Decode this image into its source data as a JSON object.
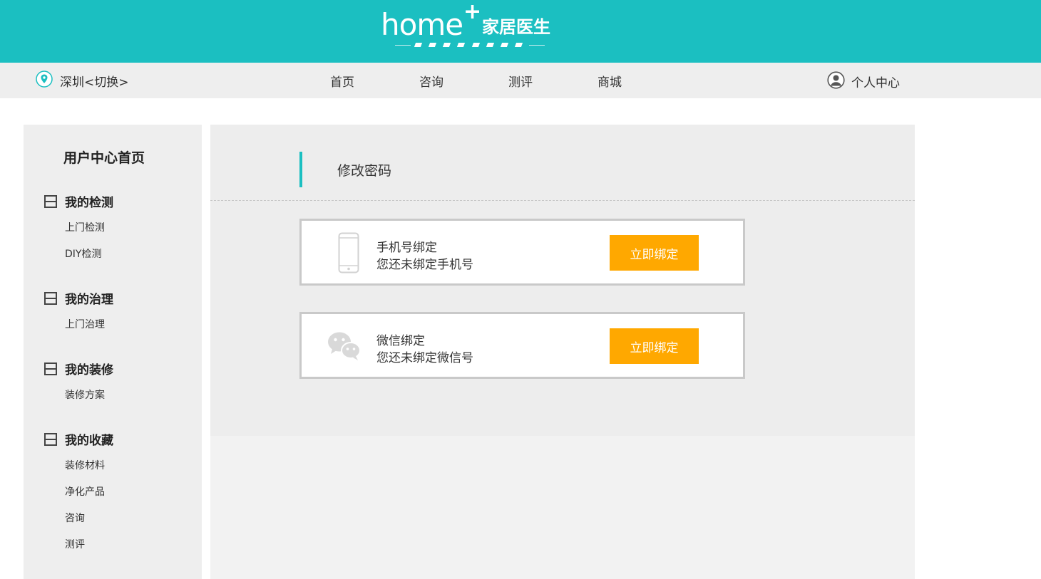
{
  "brand": {
    "logo_home": "home",
    "logo_plus": "+",
    "logo_cn": "家居医生",
    "color_primary": "#1bbfc1",
    "color_accent": "#ffa800"
  },
  "navbar": {
    "city_icon": "location-pin-icon",
    "city_label": "深圳<切换>",
    "items": [
      {
        "label": "首页"
      },
      {
        "label": "咨询"
      },
      {
        "label": "测评"
      },
      {
        "label": "商城"
      }
    ],
    "user_icon": "user-avatar-icon",
    "user_center_label": "个人中心"
  },
  "sidebar": {
    "title": "用户中心首页",
    "sections": [
      {
        "label": "我的检测",
        "icon": "collapse-box-icon",
        "links": [
          "上门检测",
          "DIY检测"
        ]
      },
      {
        "label": "我的治理",
        "icon": "collapse-box-icon",
        "links": [
          "上门治理"
        ]
      },
      {
        "label": "我的装修",
        "icon": "collapse-box-icon",
        "links": [
          "装修方案"
        ]
      },
      {
        "label": "我的收藏",
        "icon": "collapse-box-icon",
        "links": [
          "装修材料",
          "净化产品",
          "咨询",
          "测评"
        ]
      }
    ]
  },
  "main": {
    "section_title": "修改密码",
    "bindings": [
      {
        "icon": "mobile-phone-icon",
        "title": "手机号绑定",
        "desc": "您还未绑定手机号",
        "button": "立即绑定"
      },
      {
        "icon": "wechat-icon",
        "title": "微信绑定",
        "desc": "您还未绑定微信号",
        "button": "立即绑定"
      }
    ]
  }
}
